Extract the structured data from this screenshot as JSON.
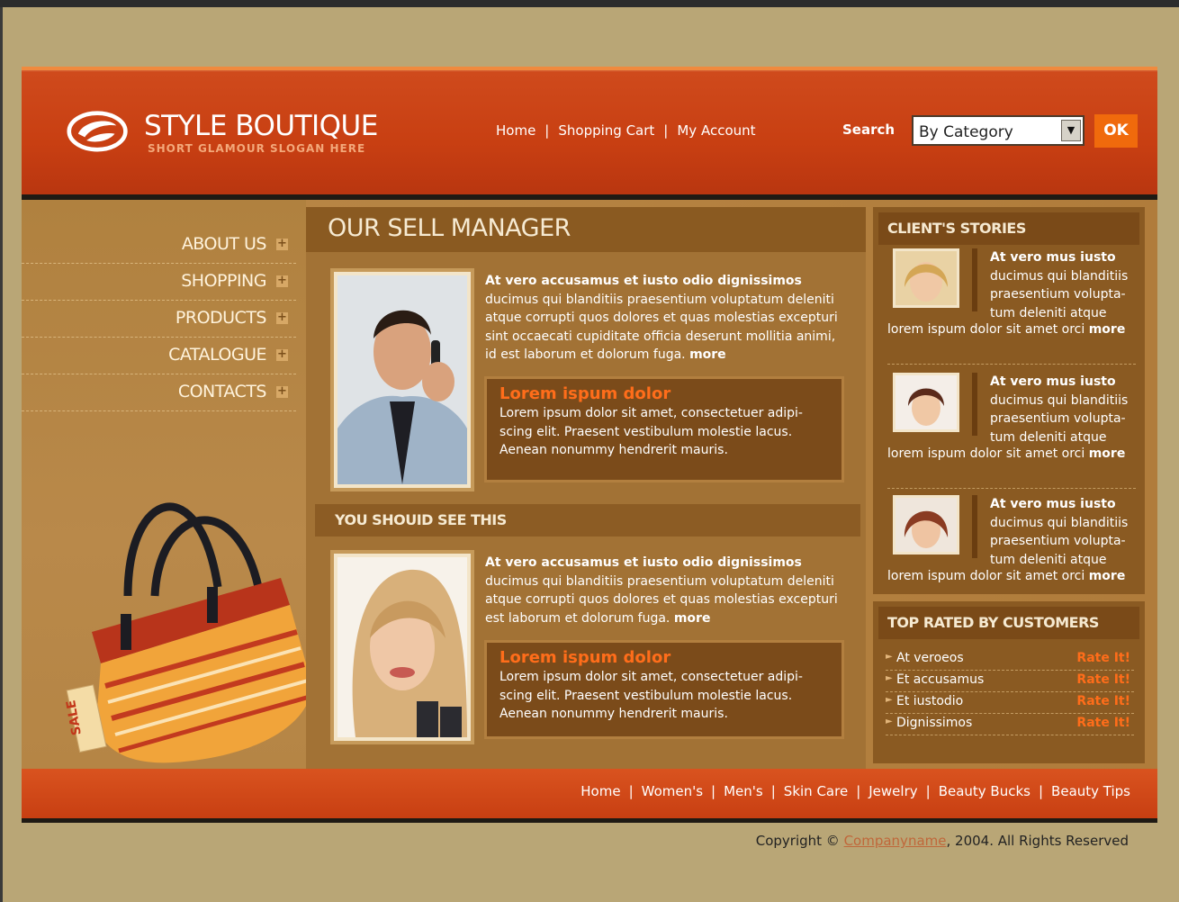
{
  "header": {
    "logo_title": "STYLE BOUTIQUE",
    "logo_slogan": "SHORT GLAMOUR SLOGAN HERE",
    "nav": [
      "Home",
      "Shopping Cart",
      "My Account"
    ],
    "search_label": "Search",
    "search_select_value": "By Category",
    "ok_label": "OK"
  },
  "sidebar": {
    "items": [
      {
        "label": "ABOUT US"
      },
      {
        "label": "SHOPPING"
      },
      {
        "label": "PRODUCTS"
      },
      {
        "label": "CATALOGUE"
      },
      {
        "label": "CONTACTS"
      }
    ],
    "sale_tag": "SALE"
  },
  "main": {
    "title": "OUR SELL MANAGER",
    "article1": {
      "heading": "At vero accusamus et iusto odio dignissimos",
      "body": "ducimus qui blanditiis praesentium voluptatum deleniti atque corrupti quos dolores et quas molestias excepturi sint occaecati cupiditate officia deserunt mollitia animi, id est laborum et dolorum fuga.",
      "more": "more",
      "box_heading": "Lorem ispum dolor",
      "box_body": "Lorem ipsum dolor sit amet, consectetuer adipi- scing elit. Praesent vestibulum molestie lacus. Aenean nonummy hendrerit mauris."
    },
    "subtitle": "YOU SHOUID SEE THIS",
    "article2": {
      "heading": "At vero accusamus et iusto odio dignissimos",
      "body": "ducimus qui blanditiis praesentium voluptatum deleniti atque corrupti quos dolores et quas molestias excepturi est laborum et dolorum fuga.",
      "more": "more",
      "box_heading": "Lorem ispum dolor",
      "box_body": "Lorem ipsum dolor sit amet, consectetuer adipi- scing elit. Praesent vestibulum molestie lacus. Aenean nonummy hendrerit mauris."
    }
  },
  "stories": {
    "title": "CLIENT'S STORIES",
    "items": [
      {
        "heading": "At vero mus iusto",
        "body": "ducimus qui blanditiis praesentium volupta- tum deleniti atque",
        "lorem": "lorem ispum dolor sit amet orci",
        "more": "more"
      },
      {
        "heading": "At vero mus iusto",
        "body": "ducimus qui blanditiis praesentium volupta- tum deleniti atque",
        "lorem": "lorem ispum dolor sit amet orci",
        "more": "more"
      },
      {
        "heading": "At vero mus iusto",
        "body": "ducimus qui blanditiis praesentium volupta- tum deleniti atque",
        "lorem": "lorem ispum dolor sit amet orci",
        "more": "more"
      }
    ]
  },
  "top_rated": {
    "title": "TOP RATED BY CUSTOMERS",
    "rate_label": "Rate It!",
    "items": [
      "At veroeos",
      "Et accusamus",
      "Et iustodio",
      "Dignissimos"
    ]
  },
  "footer": {
    "nav": [
      "Home",
      "Women's",
      "Men's",
      "Skin Care",
      "Jewelry",
      "Beauty Bucks",
      "Beauty Tips"
    ],
    "copyright_prefix": "Copyright ©",
    "company": "Companyname",
    "copyright_suffix": ", 2004. All Rights Reserved"
  },
  "colors": {
    "accent_orange": "#f06a0c",
    "header_red": "#c83f12",
    "body_brown": "#a27235",
    "page_bg": "#b9a676"
  }
}
